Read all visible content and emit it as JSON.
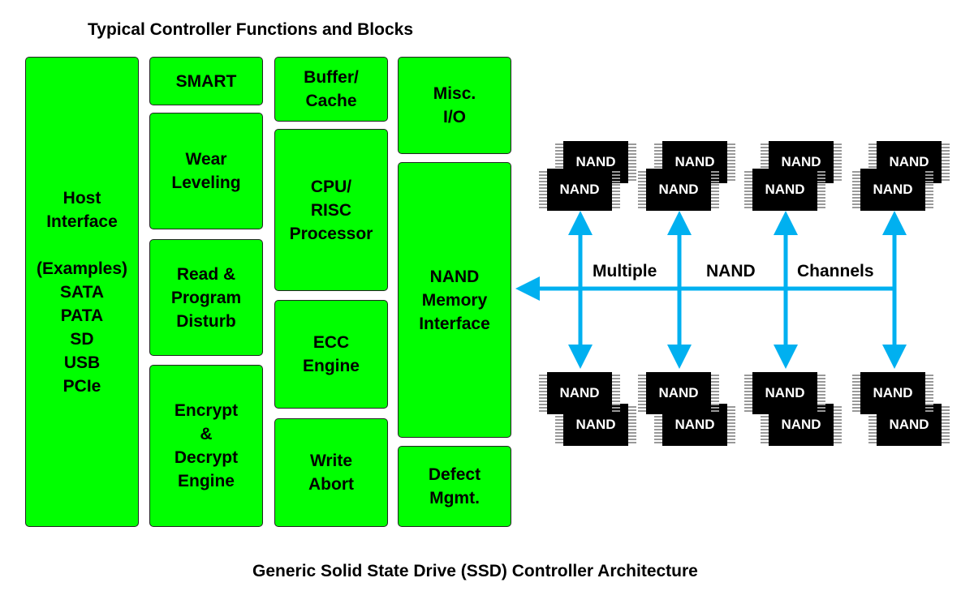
{
  "titles": {
    "top": "Typical Controller Functions and Blocks",
    "bottom": "Generic Solid State Drive (SSD) Controller Architecture"
  },
  "blocks": {
    "host": "Host\nInterface\n\n(Examples)\nSATA\nPATA\nSD\nUSB\nPCIe",
    "smart": "SMART",
    "wear": "Wear\nLeveling",
    "read": "Read &\nProgram\nDisturb",
    "encrypt": "Encrypt\n&\nDecrypt\nEngine",
    "buffer": "Buffer/\nCache",
    "cpu": "CPU/\nRISC\nProcessor",
    "ecc": "ECC\nEngine",
    "write": "Write\nAbort",
    "misc": "Misc.\nI/O",
    "nand_if": "NAND\nMemory\nInterface",
    "defect": "Defect\nMgmt."
  },
  "channels": {
    "labels": [
      "Multiple",
      "NAND",
      "Channels"
    ],
    "count": 4,
    "chip_label": "NAND"
  },
  "colors": {
    "block_fill": "#00ff00",
    "arrow": "#00b0f0",
    "chip": "#000000"
  }
}
